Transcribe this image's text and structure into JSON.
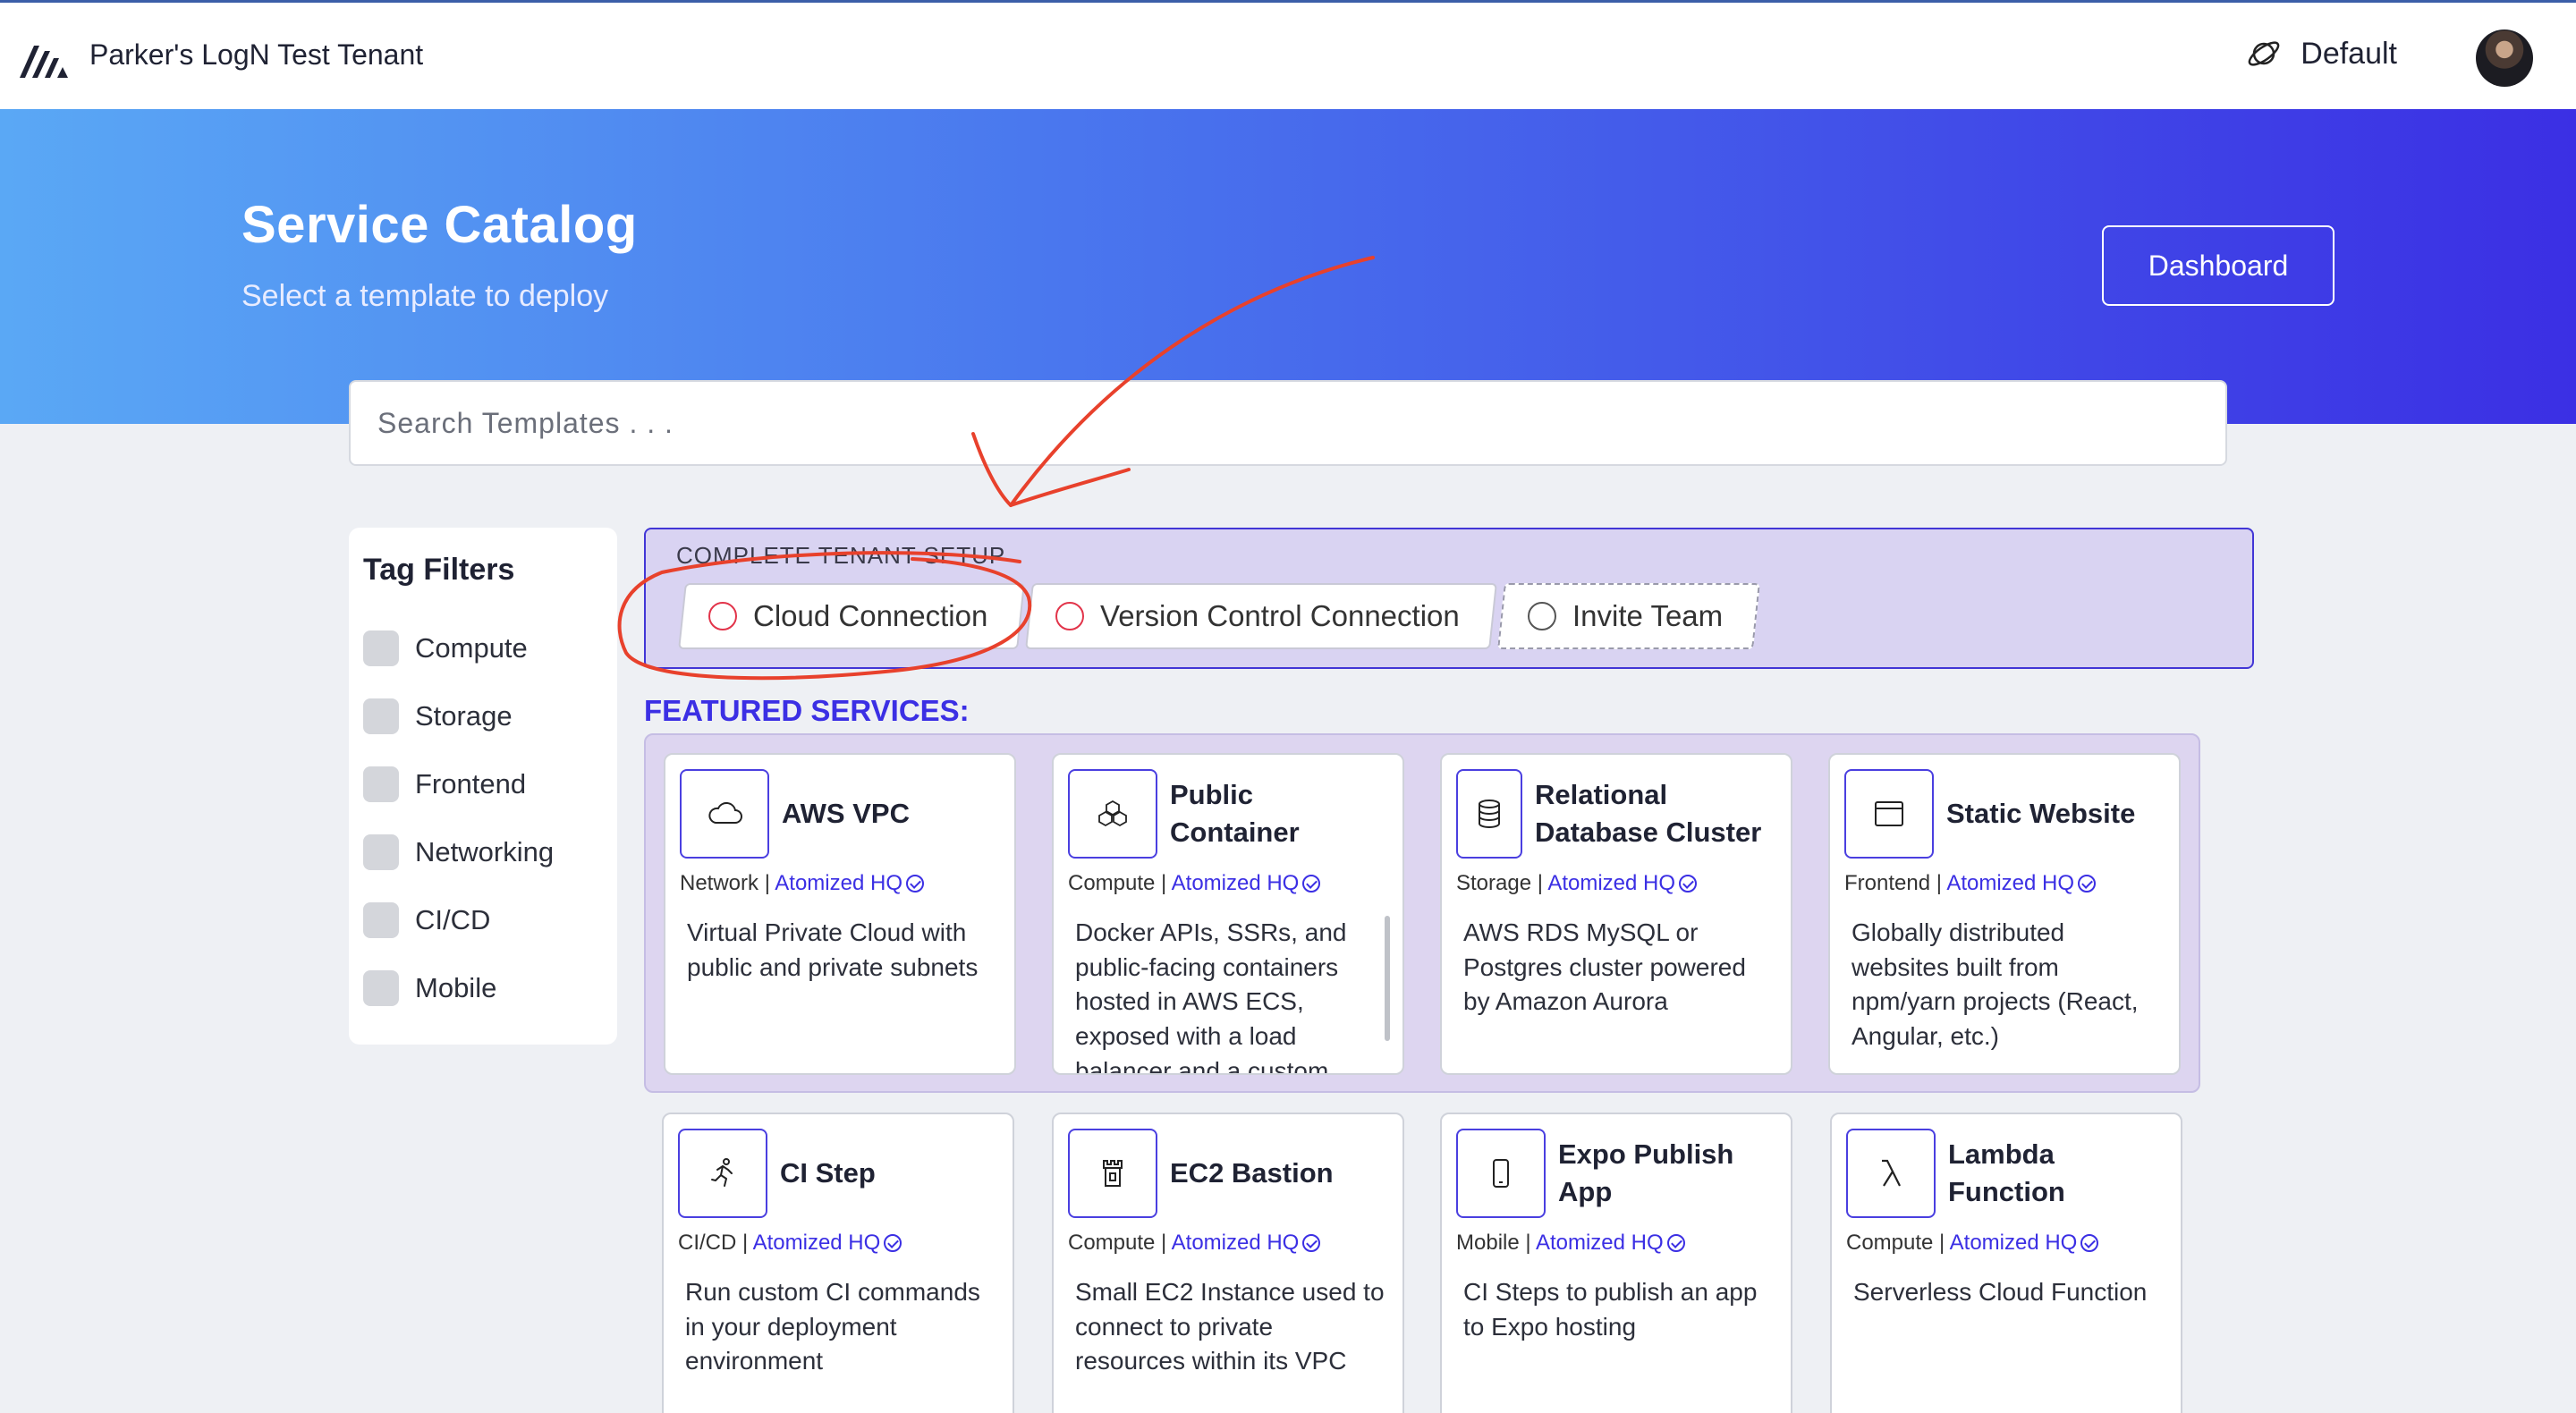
{
  "header": {
    "tenant_name": "Parker's LogN Test Tenant",
    "environment": "Default",
    "environment_icon": "planet-icon"
  },
  "hero": {
    "title": "Service Catalog",
    "subtitle": "Select a template to deploy",
    "dashboard_button": "Dashboard"
  },
  "search": {
    "placeholder": "Search Templates . . ."
  },
  "tag_filters": {
    "title": "Tag Filters",
    "items": [
      {
        "label": "Compute",
        "checked": false
      },
      {
        "label": "Storage",
        "checked": false
      },
      {
        "label": "Frontend",
        "checked": false
      },
      {
        "label": "Networking",
        "checked": false
      },
      {
        "label": "CI/CD",
        "checked": false
      },
      {
        "label": "Mobile",
        "checked": false
      }
    ]
  },
  "setup": {
    "title": "COMPLETE TENANT SETUP",
    "steps": [
      {
        "label": "Cloud Connection",
        "status_color": "#e2344a"
      },
      {
        "label": "Version Control Connection",
        "status_color": "#e2344a"
      },
      {
        "label": "Invite Team",
        "status_color": "#555555"
      }
    ]
  },
  "featured_heading": "FEATURED SERVICES:",
  "cards": [
    {
      "title": "AWS VPC",
      "category": "Network",
      "org": "Atomized HQ",
      "icon": "cloud-icon",
      "description": "Virtual Private Cloud with public and private subnets"
    },
    {
      "title": "Public Container",
      "category": "Compute",
      "org": "Atomized HQ",
      "icon": "cubes-icon",
      "description": "Docker APIs, SSRs, and public-facing containers hosted in AWS ECS, exposed with a load balancer and a custom"
    },
    {
      "title": "Relational Database Cluster",
      "category": "Storage",
      "org": "Atomized HQ",
      "icon": "database-icon",
      "description": "AWS RDS MySQL or Postgres cluster powered by Amazon Aurora"
    },
    {
      "title": "Static Website",
      "category": "Frontend",
      "org": "Atomized HQ",
      "icon": "browser-window-icon",
      "description": "Globally distributed websites built from npm/yarn projects (React, Angular, etc.)"
    },
    {
      "title": "CI Step",
      "category": "CI/CD",
      "org": "Atomized HQ",
      "icon": "runner-icon",
      "description": "Run custom CI commands in your deployment environment"
    },
    {
      "title": "EC2 Bastion",
      "category": "Compute",
      "org": "Atomized HQ",
      "icon": "tower-icon",
      "description": "Small EC2 Instance used to connect to private resources within its VPC"
    },
    {
      "title": "Expo Publish App",
      "category": "Mobile",
      "org": "Atomized HQ",
      "icon": "phone-icon",
      "description": "CI Steps to publish an app to Expo hosting"
    },
    {
      "title": "Lambda Function",
      "category": "Compute",
      "org": "Atomized HQ",
      "icon": "lambda-icon",
      "description": "Serverless Cloud Function"
    }
  ],
  "annotation_color": "#e8412c"
}
